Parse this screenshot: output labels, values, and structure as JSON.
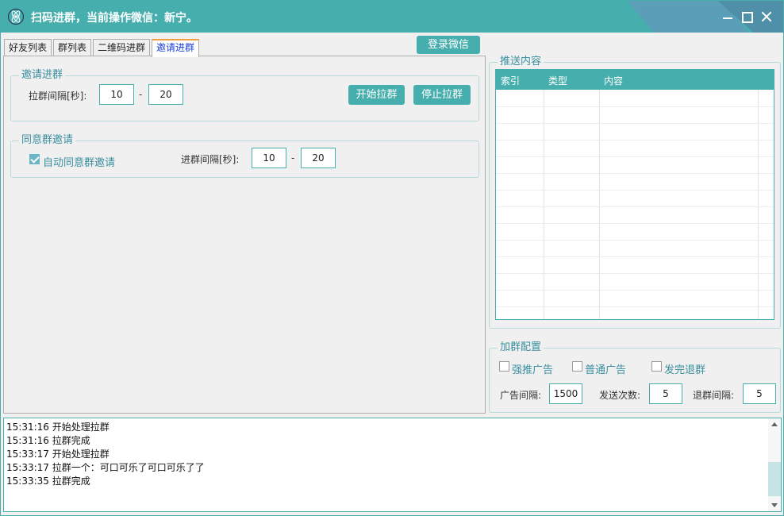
{
  "window": {
    "title": "扫码进群，当前操作微信：新宁。"
  },
  "tabs": [
    {
      "label": "好友列表"
    },
    {
      "label": "群列表"
    },
    {
      "label": "二维码进群"
    },
    {
      "label": "邀请进群",
      "active": true
    }
  ],
  "login_button": "登录微信",
  "invite_group": {
    "title": "邀请进群",
    "interval_label": "拉群间隔[秒]:",
    "interval_min": "10",
    "interval_max": "20",
    "dash": "-",
    "start_button": "开始拉群",
    "stop_button": "停止拉群"
  },
  "accept_group": {
    "title": "同意群邀请",
    "auto_accept_label": "自动同意群邀请",
    "auto_accept_checked": true,
    "interval_label": "进群间隔[秒]:",
    "interval_min": "10",
    "interval_max": "20",
    "dash": "-"
  },
  "push_content": {
    "title": "推送内容",
    "columns": [
      "索引",
      "类型",
      "内容"
    ],
    "rows": []
  },
  "join_config": {
    "title": "加群配置",
    "options": [
      {
        "label": "强推广告",
        "checked": false
      },
      {
        "label": "普通广告",
        "checked": false
      },
      {
        "label": "发完退群",
        "checked": false
      }
    ],
    "ad_interval_label": "广告间隔:",
    "ad_interval": "1500",
    "send_count_label": "发送次数:",
    "send_count": "5",
    "quit_interval_label": "退群间隔:",
    "quit_interval": "5"
  },
  "log": [
    "15:31:16 开始处理拉群",
    "15:31:16 拉群完成",
    "15:33:17 开始处理拉群",
    "15:33:17 拉群一个：可口可乐了可口可乐了了",
    "15:33:35 拉群完成"
  ],
  "colors": {
    "accent": "#47aeae",
    "active_tab_text": "#1a3cd8",
    "group_title": "#3a8fa0"
  },
  "icons": {
    "app": "atom-icon",
    "minimize": "minimize-icon",
    "maximize": "maximize-icon",
    "close": "close-icon"
  }
}
